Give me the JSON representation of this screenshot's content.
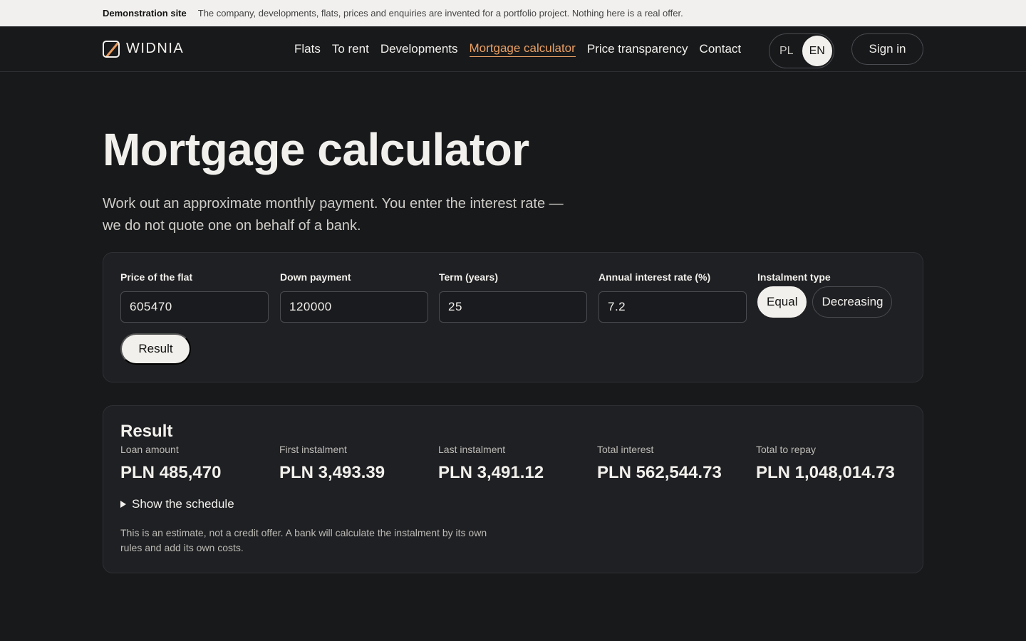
{
  "demo_bar": {
    "title": "Demonstration site",
    "text": "The company, developments, flats, prices and enquiries are invented for a portfolio project. Nothing here is a real offer."
  },
  "header": {
    "logo_text": "WIDNIA",
    "nav": [
      "Flats",
      "To rent",
      "Developments",
      "Mortgage calculator",
      "Price transparency",
      "Contact"
    ],
    "active_nav": "Mortgage calculator",
    "lang": {
      "pl": "PL",
      "en": "EN",
      "selected": "EN"
    },
    "sign_in": "Sign in"
  },
  "hero": {
    "title": "Mortgage calculator",
    "subtitle": "Work out an approximate monthly payment. You enter the interest rate — we do not quote one on behalf of a bank."
  },
  "form": {
    "fields": [
      {
        "label": "Price of the flat",
        "value": "605470"
      },
      {
        "label": "Down payment",
        "value": "120000"
      },
      {
        "label": "Term (years)",
        "value": "25"
      },
      {
        "label": "Annual interest rate (%)",
        "value": "7.2"
      }
    ],
    "instalment_type": {
      "label": "Instalment type",
      "options": [
        "Equal",
        "Decreasing"
      ],
      "selected": "Equal"
    },
    "submit": "Result"
  },
  "result": {
    "title": "Result",
    "stats": [
      {
        "label": "Loan amount",
        "value": "PLN 485,470"
      },
      {
        "label": "First instalment",
        "value": "PLN 3,493.39"
      },
      {
        "label": "Last instalment",
        "value": "PLN 3,491.12"
      },
      {
        "label": "Total interest",
        "value": "PLN 562,544.73"
      },
      {
        "label": "Total to repay",
        "value": "PLN 1,048,014.73"
      }
    ],
    "schedule_toggle": "Show the schedule",
    "disclaimer": "This is an estimate, not a credit offer. A bank will calculate the instalment by its own rules and add its own costs."
  },
  "colors": {
    "background": "#18191b",
    "card": "#1f2023",
    "accent": "#e9a064",
    "text": "#f2f0ec"
  }
}
